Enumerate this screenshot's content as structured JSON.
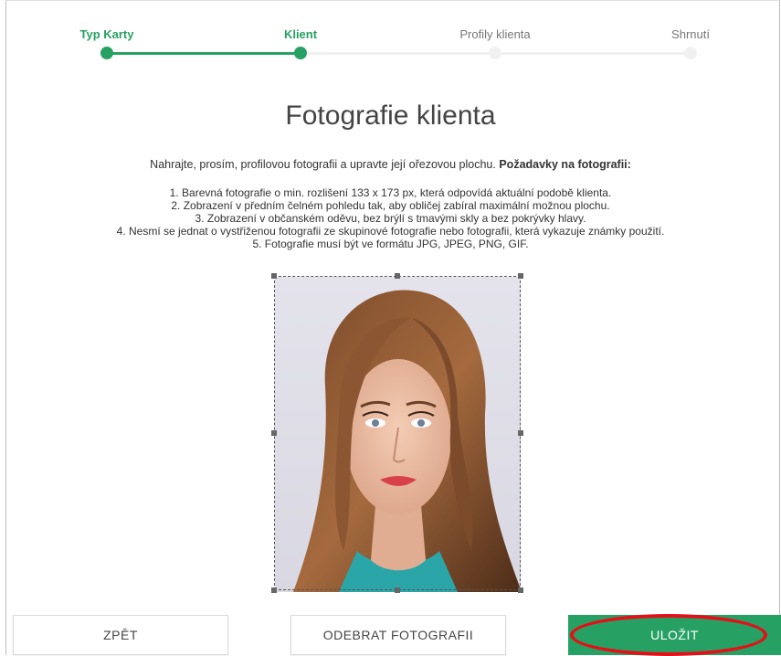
{
  "stepper": {
    "steps": [
      {
        "label": "Typ Karty",
        "state": "done"
      },
      {
        "label": "Klient",
        "state": "done"
      },
      {
        "label": "Profily klienta",
        "state": "todo"
      },
      {
        "label": "Shrnutí",
        "state": "todo"
      }
    ]
  },
  "page": {
    "title": "Fotografie klienta",
    "intro_text": "Nahrajte, prosím, profilovou fotografii a upravte její ořezovou plochu.",
    "intro_bold": "Požadavky na fotografii:"
  },
  "requirements": [
    "1. Barevná fotografie o min. rozlišení 133 x 173 px, která odpovídá aktuální podobě klienta.",
    "2. Zobrazení v předním čelném pohledu tak, aby obličej zabíral maximální možnou plochu.",
    "3. Zobrazení v občanském oděvu, bez brýlí s tmavými skly a bez pokrývky hlavy.",
    "4. Nesmí se jednat o vystřiženou fotografii ze skupinové fotografie nebo fotografii, která vykazuje známky použití.",
    "5. Fotografie musí být ve formátu JPG, JPEG, PNG, GIF."
  ],
  "buttons": {
    "back": "ZPĚT",
    "remove_photo": "ODEBRAT FOTOGRAFII",
    "save": "ULOŽIT"
  },
  "colors": {
    "accent": "#27a163",
    "highlight": "#e3101a"
  }
}
